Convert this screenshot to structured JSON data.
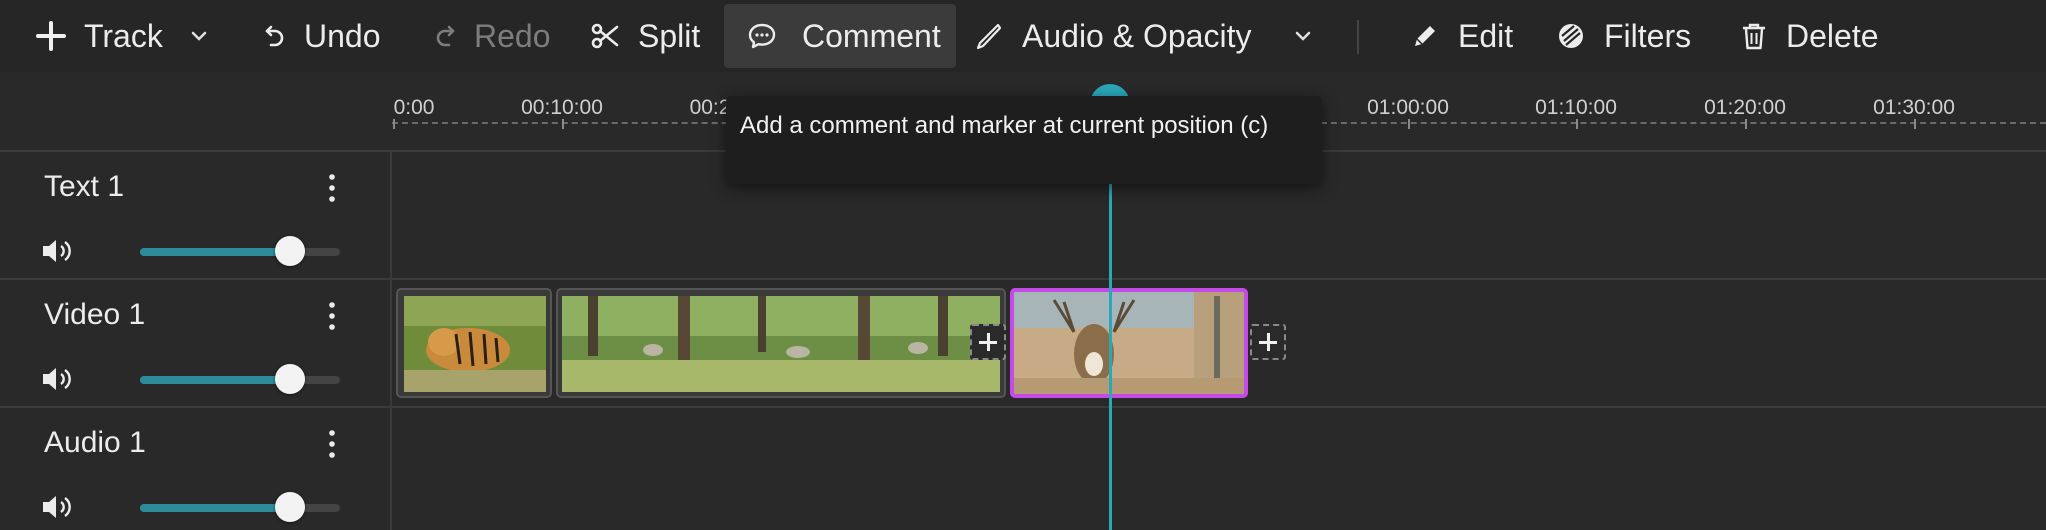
{
  "toolbar": {
    "track_label": "Track",
    "undo_label": "Undo",
    "redo_label": "Redo",
    "split_label": "Split",
    "comment_label": "Comment",
    "audio_opacity_label": "Audio & Opacity",
    "edit_label": "Edit",
    "filters_label": "Filters",
    "delete_label": "Delete"
  },
  "ruler": {
    "ticks": [
      "0:00",
      "00:10:00",
      "00:2",
      "01:00:00",
      "01:10:00",
      "01:20:00",
      "01:30:00"
    ]
  },
  "tooltip": {
    "text": "Add a comment and marker at current position (c)"
  },
  "tracks": [
    {
      "name": "Text 1",
      "volume": 0.75
    },
    {
      "name": "Video 1",
      "volume": 0.75
    },
    {
      "name": "Audio 1",
      "volume": 0.75
    }
  ],
  "colors": {
    "accent": "#2aa7b9",
    "selection": "#c44be8",
    "background": "#292929"
  },
  "icons": [
    "plus-icon",
    "chevron-down-icon",
    "undo-icon",
    "redo-icon",
    "scissors-icon",
    "comment-icon",
    "pen-icon",
    "pencil-icon",
    "filters-icon",
    "trash-icon",
    "kebab-icon",
    "volume-icon"
  ]
}
